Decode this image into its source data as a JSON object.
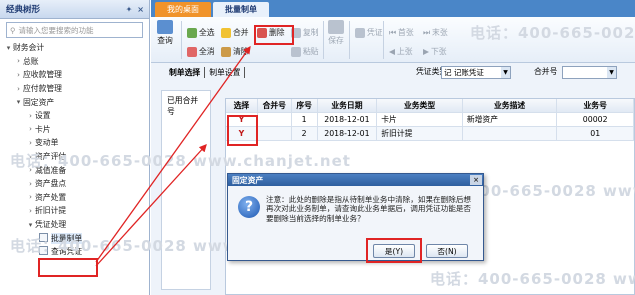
{
  "tree": {
    "title": "经典树形",
    "search_placeholder": "请输入您要搜索的功能",
    "items": [
      {
        "label": "财务会计",
        "level": 1,
        "arrow": "▾"
      },
      {
        "label": "总账",
        "level": 2,
        "arrow": "›"
      },
      {
        "label": "应收款管理",
        "level": 2,
        "arrow": "›"
      },
      {
        "label": "应付款管理",
        "level": 2,
        "arrow": "›"
      },
      {
        "label": "固定资产",
        "level": 2,
        "arrow": "▾"
      },
      {
        "label": "设置",
        "level": 3,
        "arrow": "›"
      },
      {
        "label": "卡片",
        "level": 3,
        "arrow": "›"
      },
      {
        "label": "变动单",
        "level": 3,
        "arrow": "›"
      },
      {
        "label": "资产评估",
        "level": 3,
        "arrow": "›"
      },
      {
        "label": "减值准备",
        "level": 3,
        "arrow": "›"
      },
      {
        "label": "资产盘点",
        "level": 3,
        "arrow": "›"
      },
      {
        "label": "资产处置",
        "level": 3,
        "arrow": "›"
      },
      {
        "label": "折旧计提",
        "level": 3,
        "arrow": "›"
      },
      {
        "label": "凭证处理",
        "level": 3,
        "arrow": "▾"
      },
      {
        "label": "批量制单",
        "level": 4,
        "arrow": ""
      },
      {
        "label": "查询凭证",
        "level": 4,
        "arrow": ""
      }
    ]
  },
  "tabs": {
    "home": "我的桌面",
    "active": "批量制单"
  },
  "toolbar": {
    "query": "查询",
    "select_all": "全选",
    "deselect_all": "全消",
    "merge": "合并",
    "clear": "清除",
    "delete": "删除",
    "copy": "复制",
    "paste": "粘贴",
    "save": "保存",
    "voucher": "凭证",
    "first": "首张",
    "prev": "上张",
    "next": "下张",
    "last": "末张"
  },
  "subtabs": {
    "select": "制单选择",
    "settings": "制单设置"
  },
  "filters": {
    "voucher_type_label": "凭证类别",
    "voucher_type_value": "记 记账凭证",
    "merge_no_label": "合并号"
  },
  "merged_panel_title": "已用合并号",
  "grid": {
    "columns": [
      "选择",
      "合并号",
      "序号",
      "业务日期",
      "业务类型",
      "业务描述",
      "业务号"
    ],
    "rows": [
      [
        "Y",
        "",
        "1",
        "2018-12-01",
        "卡片",
        "新增资产",
        "00002"
      ],
      [
        "Y",
        "",
        "2",
        "2018-12-01",
        "折旧计提",
        "",
        "01"
      ]
    ]
  },
  "dialog": {
    "title": "固定资产",
    "close": "×",
    "message": "注意：此处的删除是指从待制单业务中清除，如果在删除后想再次对此业务制单，请查询此业务单据后，调用凭证功能是否要删除当前选择的制单业务？",
    "yes": "是(Y)",
    "no": "否(N)"
  },
  "watermark": "电话：400-665-0028  www.chanjet.net",
  "colors": {
    "accent": "#4a86c8",
    "home_tab": "#f0932b",
    "highlight": "#e02424"
  }
}
